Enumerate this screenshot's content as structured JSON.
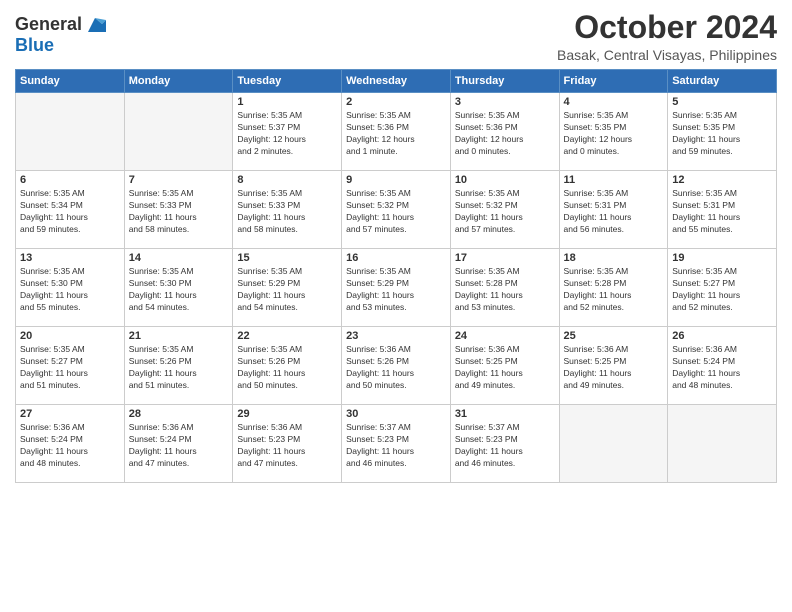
{
  "header": {
    "logo_line1": "General",
    "logo_line2": "Blue",
    "month": "October 2024",
    "location": "Basak, Central Visayas, Philippines"
  },
  "days_of_week": [
    "Sunday",
    "Monday",
    "Tuesday",
    "Wednesday",
    "Thursday",
    "Friday",
    "Saturday"
  ],
  "weeks": [
    [
      {
        "day": "",
        "empty": true
      },
      {
        "day": "",
        "empty": true
      },
      {
        "day": "1",
        "line1": "Sunrise: 5:35 AM",
        "line2": "Sunset: 5:37 PM",
        "line3": "Daylight: 12 hours",
        "line4": "and 2 minutes."
      },
      {
        "day": "2",
        "line1": "Sunrise: 5:35 AM",
        "line2": "Sunset: 5:36 PM",
        "line3": "Daylight: 12 hours",
        "line4": "and 1 minute."
      },
      {
        "day": "3",
        "line1": "Sunrise: 5:35 AM",
        "line2": "Sunset: 5:36 PM",
        "line3": "Daylight: 12 hours",
        "line4": "and 0 minutes."
      },
      {
        "day": "4",
        "line1": "Sunrise: 5:35 AM",
        "line2": "Sunset: 5:35 PM",
        "line3": "Daylight: 12 hours",
        "line4": "and 0 minutes."
      },
      {
        "day": "5",
        "line1": "Sunrise: 5:35 AM",
        "line2": "Sunset: 5:35 PM",
        "line3": "Daylight: 11 hours",
        "line4": "and 59 minutes."
      }
    ],
    [
      {
        "day": "6",
        "line1": "Sunrise: 5:35 AM",
        "line2": "Sunset: 5:34 PM",
        "line3": "Daylight: 11 hours",
        "line4": "and 59 minutes."
      },
      {
        "day": "7",
        "line1": "Sunrise: 5:35 AM",
        "line2": "Sunset: 5:33 PM",
        "line3": "Daylight: 11 hours",
        "line4": "and 58 minutes."
      },
      {
        "day": "8",
        "line1": "Sunrise: 5:35 AM",
        "line2": "Sunset: 5:33 PM",
        "line3": "Daylight: 11 hours",
        "line4": "and 58 minutes."
      },
      {
        "day": "9",
        "line1": "Sunrise: 5:35 AM",
        "line2": "Sunset: 5:32 PM",
        "line3": "Daylight: 11 hours",
        "line4": "and 57 minutes."
      },
      {
        "day": "10",
        "line1": "Sunrise: 5:35 AM",
        "line2": "Sunset: 5:32 PM",
        "line3": "Daylight: 11 hours",
        "line4": "and 57 minutes."
      },
      {
        "day": "11",
        "line1": "Sunrise: 5:35 AM",
        "line2": "Sunset: 5:31 PM",
        "line3": "Daylight: 11 hours",
        "line4": "and 56 minutes."
      },
      {
        "day": "12",
        "line1": "Sunrise: 5:35 AM",
        "line2": "Sunset: 5:31 PM",
        "line3": "Daylight: 11 hours",
        "line4": "and 55 minutes."
      }
    ],
    [
      {
        "day": "13",
        "line1": "Sunrise: 5:35 AM",
        "line2": "Sunset: 5:30 PM",
        "line3": "Daylight: 11 hours",
        "line4": "and 55 minutes."
      },
      {
        "day": "14",
        "line1": "Sunrise: 5:35 AM",
        "line2": "Sunset: 5:30 PM",
        "line3": "Daylight: 11 hours",
        "line4": "and 54 minutes."
      },
      {
        "day": "15",
        "line1": "Sunrise: 5:35 AM",
        "line2": "Sunset: 5:29 PM",
        "line3": "Daylight: 11 hours",
        "line4": "and 54 minutes."
      },
      {
        "day": "16",
        "line1": "Sunrise: 5:35 AM",
        "line2": "Sunset: 5:29 PM",
        "line3": "Daylight: 11 hours",
        "line4": "and 53 minutes."
      },
      {
        "day": "17",
        "line1": "Sunrise: 5:35 AM",
        "line2": "Sunset: 5:28 PM",
        "line3": "Daylight: 11 hours",
        "line4": "and 53 minutes."
      },
      {
        "day": "18",
        "line1": "Sunrise: 5:35 AM",
        "line2": "Sunset: 5:28 PM",
        "line3": "Daylight: 11 hours",
        "line4": "and 52 minutes."
      },
      {
        "day": "19",
        "line1": "Sunrise: 5:35 AM",
        "line2": "Sunset: 5:27 PM",
        "line3": "Daylight: 11 hours",
        "line4": "and 52 minutes."
      }
    ],
    [
      {
        "day": "20",
        "line1": "Sunrise: 5:35 AM",
        "line2": "Sunset: 5:27 PM",
        "line3": "Daylight: 11 hours",
        "line4": "and 51 minutes."
      },
      {
        "day": "21",
        "line1": "Sunrise: 5:35 AM",
        "line2": "Sunset: 5:26 PM",
        "line3": "Daylight: 11 hours",
        "line4": "and 51 minutes."
      },
      {
        "day": "22",
        "line1": "Sunrise: 5:35 AM",
        "line2": "Sunset: 5:26 PM",
        "line3": "Daylight: 11 hours",
        "line4": "and 50 minutes."
      },
      {
        "day": "23",
        "line1": "Sunrise: 5:36 AM",
        "line2": "Sunset: 5:26 PM",
        "line3": "Daylight: 11 hours",
        "line4": "and 50 minutes."
      },
      {
        "day": "24",
        "line1": "Sunrise: 5:36 AM",
        "line2": "Sunset: 5:25 PM",
        "line3": "Daylight: 11 hours",
        "line4": "and 49 minutes."
      },
      {
        "day": "25",
        "line1": "Sunrise: 5:36 AM",
        "line2": "Sunset: 5:25 PM",
        "line3": "Daylight: 11 hours",
        "line4": "and 49 minutes."
      },
      {
        "day": "26",
        "line1": "Sunrise: 5:36 AM",
        "line2": "Sunset: 5:24 PM",
        "line3": "Daylight: 11 hours",
        "line4": "and 48 minutes."
      }
    ],
    [
      {
        "day": "27",
        "line1": "Sunrise: 5:36 AM",
        "line2": "Sunset: 5:24 PM",
        "line3": "Daylight: 11 hours",
        "line4": "and 48 minutes."
      },
      {
        "day": "28",
        "line1": "Sunrise: 5:36 AM",
        "line2": "Sunset: 5:24 PM",
        "line3": "Daylight: 11 hours",
        "line4": "and 47 minutes."
      },
      {
        "day": "29",
        "line1": "Sunrise: 5:36 AM",
        "line2": "Sunset: 5:23 PM",
        "line3": "Daylight: 11 hours",
        "line4": "and 47 minutes."
      },
      {
        "day": "30",
        "line1": "Sunrise: 5:37 AM",
        "line2": "Sunset: 5:23 PM",
        "line3": "Daylight: 11 hours",
        "line4": "and 46 minutes."
      },
      {
        "day": "31",
        "line1": "Sunrise: 5:37 AM",
        "line2": "Sunset: 5:23 PM",
        "line3": "Daylight: 11 hours",
        "line4": "and 46 minutes."
      },
      {
        "day": "",
        "empty": true
      },
      {
        "day": "",
        "empty": true
      }
    ]
  ]
}
